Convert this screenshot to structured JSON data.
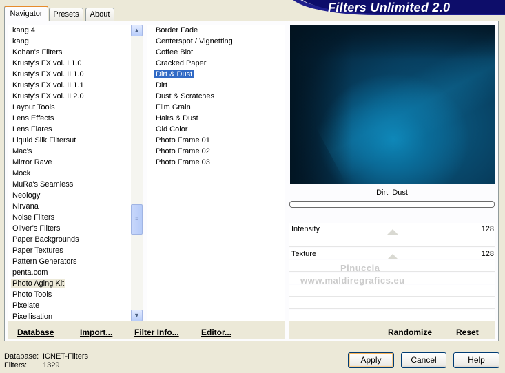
{
  "tabs": [
    {
      "label": "Navigator"
    },
    {
      "label": "Presets"
    },
    {
      "label": "About"
    }
  ],
  "header": {
    "title": "Filters Unlimited 2.0"
  },
  "categories": {
    "items": [
      "kang 4",
      "kang",
      "Kohan's Filters",
      "Krusty's FX vol. I 1.0",
      "Krusty's FX vol. II 1.0",
      "Krusty's FX vol. II 1.1",
      "Krusty's FX vol. II 2.0",
      "Layout Tools",
      "Lens Effects",
      "Lens Flares",
      "Liquid Silk Filtersut",
      "Mac's",
      "Mirror Rave",
      "Mock",
      "MuRa's Seamless",
      "Neology",
      "Nirvana",
      "Noise Filters",
      "Oliver's Filters",
      "Paper Backgrounds",
      "Paper Textures",
      "Pattern Generators",
      "penta.com",
      "Photo Aging Kit",
      "Photo Tools",
      "Pixelate",
      "Pixellisation"
    ],
    "highlighted": "Photo Aging Kit"
  },
  "filters": {
    "items": [
      "Border Fade",
      "Centerspot / Vignetting",
      "Coffee Blot",
      "Cracked Paper",
      "Dirt & Dust",
      "Dirt",
      "Dust & Scratches",
      "Film Grain",
      "Hairs & Dust",
      "Old Color",
      "Photo Frame 01",
      "Photo Frame 02",
      "Photo Frame 03"
    ],
    "selected": "Dirt & Dust"
  },
  "preview": {
    "caption": "Dirt  Dust"
  },
  "sliders": [
    {
      "label": "Intensity",
      "value": "128"
    },
    {
      "label": "Texture",
      "value": "128"
    }
  ],
  "watermark": {
    "line1": "Pinuccia",
    "line2": "www.maldiregrafics.eu"
  },
  "left_bar": {
    "database": "Database",
    "import": "Import...",
    "filter_info": "Filter Info...",
    "editor": "Editor..."
  },
  "right_bar": {
    "randomize": "Randomize",
    "reset": "Reset"
  },
  "status": {
    "database_label": "Database:",
    "database_value": "ICNET-Filters",
    "filters_label": "Filters:",
    "filters_value": "1329"
  },
  "buttons": {
    "apply": "Apply",
    "cancel": "Cancel",
    "help": "Help"
  },
  "colors": {
    "selection": "#316ac5",
    "banner": "#0d0d6a",
    "preview_accent": "#0e87b8"
  }
}
